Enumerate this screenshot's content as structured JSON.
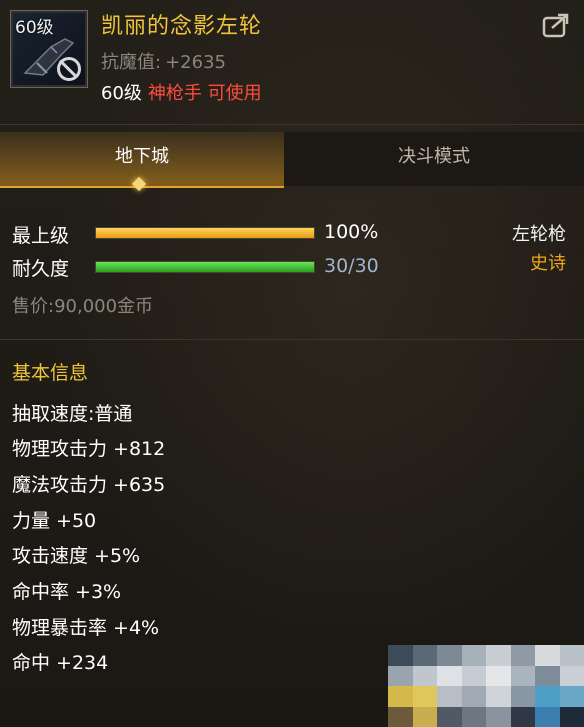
{
  "item": {
    "level_badge": "60级",
    "name": "凯丽的念影左轮",
    "magic_resist_label": "抗魔值:",
    "magic_resist_value": "+2635",
    "req_level": "60级",
    "req_class": "神枪手 可使用"
  },
  "icons": {
    "share": "share-icon",
    "untradable": "no-trade-icon",
    "diamond": "tab-indicator-icon"
  },
  "tabs": [
    {
      "label": "地下城",
      "active": true
    },
    {
      "label": "决斗模式",
      "active": false
    }
  ],
  "stats": {
    "grade_label": "最上级",
    "grade_value": "100%",
    "grade_fill": 1.0,
    "durability_label": "耐久度",
    "durability_value": "30/30",
    "durability_fill": 1.0,
    "weapon_type": "左轮枪",
    "rarity": "史诗",
    "price": "售价:90,000金币"
  },
  "basic_info": {
    "title": "基本信息",
    "attributes": [
      "抽取速度:普通",
      "物理攻击力 +812",
      "魔法攻击力 +635",
      "力量 +50",
      "攻击速度 +5%",
      "命中率 +3%",
      "物理暴击率 +4%",
      "命中 +234"
    ]
  },
  "colors": {
    "title_gold": "#f0c53c",
    "class_red": "#ff4b3c",
    "rarity_orange": "#f0a51e",
    "durability_value": "#9fb4cf"
  }
}
